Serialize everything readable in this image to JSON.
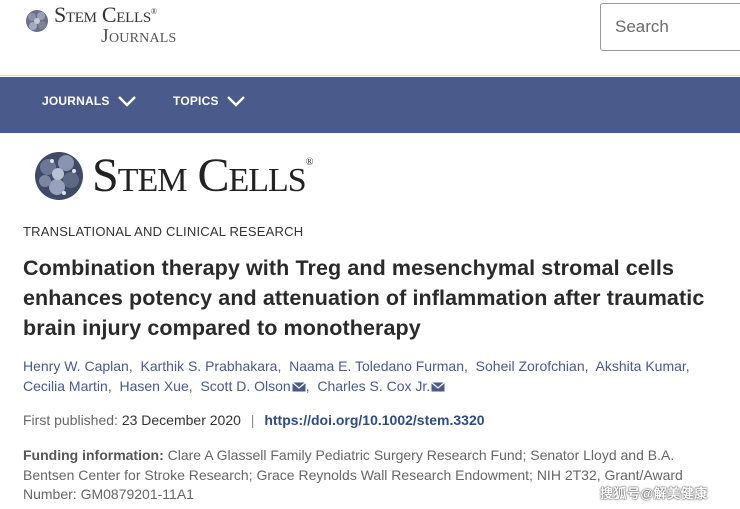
{
  "site_header": {
    "logo_line1": "Stem Cells",
    "logo_reg": "®",
    "logo_line2": "Journals",
    "search_placeholder": "Search"
  },
  "nav": {
    "journals_label": "JOURNALS",
    "topics_label": "TOPICS"
  },
  "masthead": {
    "title": "Stem Cells",
    "reg": "®"
  },
  "article": {
    "section": "TRANSLATIONAL AND CLINICAL RESEARCH",
    "title": "Combination therapy with Treg and mesenchymal stromal cells enhances potency and attenuation of inflammation after traumatic brain injury compared to monotherapy",
    "authors": [
      {
        "name": "Henry W. Caplan",
        "sep": ",",
        "mail": false
      },
      {
        "name": "Karthik S. Prabhakara",
        "sep": ",",
        "mail": false
      },
      {
        "name": "Naama E. Toledano Furman",
        "sep": ",",
        "mail": false
      },
      {
        "name": "Soheil Zorofchian",
        "sep": ",",
        "mail": false
      },
      {
        "name": "Akshita Kumar",
        "sep": ",",
        "mail": false
      },
      {
        "name": "Cecilia Martin",
        "sep": ",",
        "mail": false
      },
      {
        "name": "Hasen Xue",
        "sep": ",",
        "mail": false
      },
      {
        "name": "Scott D. Olson",
        "sep": ",",
        "mail": true
      },
      {
        "name": "Charles S. Cox Jr.",
        "sep": "",
        "mail": true
      }
    ],
    "first_published_label": "First published:",
    "first_published_date": "23 December 2020",
    "pipe": "|",
    "doi": "https://doi.org/10.1002/stem.3320",
    "funding_label": "Funding information:",
    "funding_text": "Clare A Glassell Family Pediatric Surgery Research Fund; Senator Lloyd and B.A. Bentsen Center for Stroke Research; Grace Reynolds Wall Research Endowment; NIH 2T32, Grant/Award Number: GM0879201-11A1"
  },
  "watermark": "搜狐号@解美健康",
  "colors": {
    "nav_bg": "#4a5a8a",
    "author_link": "#4a5a8a",
    "doi_link": "#2e4b86"
  },
  "icons": {
    "logo_mark": "cell-cluster-icon",
    "chevron": "chevron-down-icon",
    "mail": "envelope-icon"
  }
}
